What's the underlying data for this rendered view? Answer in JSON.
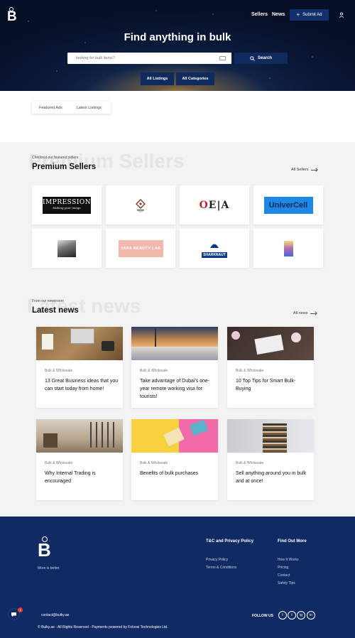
{
  "header": {
    "logo_letter": "B",
    "nav": [
      "Sellers",
      "News"
    ],
    "submit_label": "Submit Ad",
    "title": "Find anything in bulk",
    "search_placeholder": "looking for bulk items?",
    "search_button": "Search",
    "buttons": [
      "All Listings",
      "All Categories"
    ]
  },
  "tabs": [
    "Featured Ads",
    "Latest Listings"
  ],
  "sellers": {
    "ghost": "Premium Sellers",
    "eyebrow": "Checkout our featured sellers",
    "title": "Premium Sellers",
    "see_all": "All Sellers",
    "logos": [
      {
        "name": "impressions",
        "line1": "IMPRESSIONS",
        "line2": "Making your image"
      },
      {
        "name": "emblem",
        "text": ""
      },
      {
        "name": "oea",
        "text": "OE|A"
      },
      {
        "name": "univercell",
        "text": "UniverCell"
      },
      {
        "name": "photo-logo",
        "text": ""
      },
      {
        "name": "yara-beauty-lab",
        "text": "YARA BEAUTY LAB"
      },
      {
        "name": "sharknaut",
        "text": "SHARKNAUT"
      },
      {
        "name": "gradient-box",
        "text": ""
      }
    ]
  },
  "news": {
    "ghost": "Latest news",
    "eyebrow": "From our newsroom",
    "title": "Latest news",
    "see_all": "All news",
    "items": [
      {
        "category": "Bulk & Wholesale",
        "title": "13 Great Business ideas that you can start today from home!"
      },
      {
        "category": "Bulk & Wholesale",
        "title": "Take advantage of Dubai's one-year remote working visa for tourists!"
      },
      {
        "category": "Bulk & Wholesale",
        "title": "10 Top Tips for Smart Bulk-Buying"
      },
      {
        "category": "Bulk & Wholesale",
        "title": "Why Internal Trading is encouraged"
      },
      {
        "category": "Bulk & Wholesale",
        "title": "Benefits of bulk purchases"
      },
      {
        "category": "Bulk & Wholesale",
        "title": "Sell anything around you in bulk and at once!"
      }
    ]
  },
  "footer": {
    "logo_letter": "B",
    "tagline": "More is better.",
    "col1_title": "T&C and Privacy Policy",
    "col1_links": [
      "Privacy Policy",
      "Terms & Conditions"
    ],
    "col2_title": "Find Out More",
    "col2_links": [
      "How It Works",
      "Pricing",
      "Contact",
      "Safety Tips"
    ],
    "email": "contact@bulky.ae",
    "follow": "FOLLOW US",
    "social": [
      "f",
      "t",
      "ig",
      "in"
    ],
    "copyright": "© Bulky.ae - All Rights Reserved - Payments powered by Foloosi Technologies Ltd.",
    "chat_badge": "1"
  },
  "colors": {
    "navy": "#102a63",
    "button": "#0f2a5c",
    "accent": "#e53935"
  }
}
